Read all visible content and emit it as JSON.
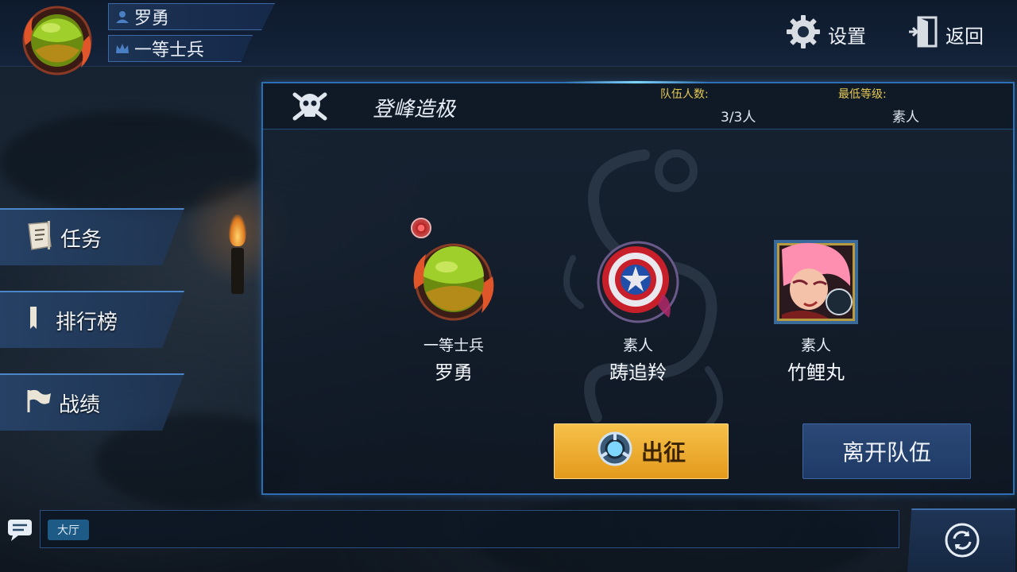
{
  "player": {
    "name": "罗勇",
    "rank": "一等士兵"
  },
  "top_actions": {
    "settings_label": "设置",
    "back_label": "返回"
  },
  "menu": {
    "items": [
      {
        "label": "任务",
        "icon": "quest-scroll-icon"
      },
      {
        "label": "排行榜",
        "icon": "ranking-bookmark-icon"
      },
      {
        "label": "战绩",
        "icon": "flag-icon"
      }
    ]
  },
  "team": {
    "mode_title": "登峰造极",
    "count_label": "队伍人数:",
    "count_value": "3/3人",
    "min_level_label": "最低等级:",
    "min_level_value": "素人",
    "members": [
      {
        "rank": "一等士兵",
        "name": "罗勇",
        "avatar": "green-orb-flame-avatar"
      },
      {
        "rank": "素人",
        "name": "踌追羚",
        "avatar": "shield-star-avatar"
      },
      {
        "rank": "素人",
        "name": "竹鲤丸",
        "avatar": "pink-hair-hero-avatar"
      }
    ],
    "start_label": "出征",
    "leave_label": "离开队伍"
  },
  "chat": {
    "channel_label": "大厅"
  },
  "colors": {
    "panel_border": "#2d6fb5",
    "start_button": "#f0b236",
    "leave_button": "#243f6d",
    "stat_label": "#e6c955"
  }
}
